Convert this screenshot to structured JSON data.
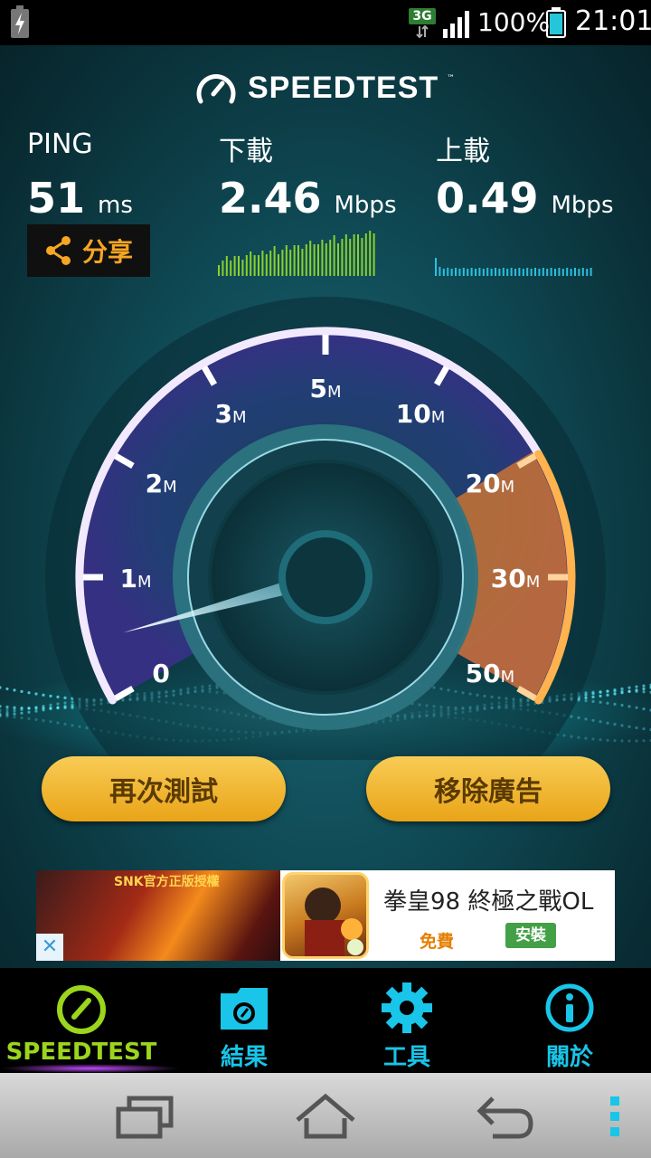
{
  "status_bar": {
    "network": "3G",
    "battery_percent": "100%",
    "time": "21:01"
  },
  "app": {
    "logo_text": "SPEEDTEST",
    "logo_tm": "™"
  },
  "stats": {
    "ping": {
      "label": "PING",
      "value": "51",
      "unit": "ms"
    },
    "download": {
      "label": "下載",
      "value": "2.46",
      "unit": "Mbps"
    },
    "upload": {
      "label": "上載",
      "value": "0.49",
      "unit": "Mbps"
    }
  },
  "share_button": {
    "label": "分享"
  },
  "gauge": {
    "tick_labels": [
      {
        "num": "0",
        "unit": ""
      },
      {
        "num": "1",
        "unit": "M"
      },
      {
        "num": "2",
        "unit": "M"
      },
      {
        "num": "3",
        "unit": "M"
      },
      {
        "num": "5",
        "unit": "M"
      },
      {
        "num": "10",
        "unit": "M"
      },
      {
        "num": "20",
        "unit": "M"
      },
      {
        "num": "30",
        "unit": "M"
      },
      {
        "num": "50",
        "unit": "M"
      }
    ],
    "needle_value_mbps": 0.49
  },
  "actions": {
    "retest": "再次測試",
    "remove_ads": "移除廣告"
  },
  "ad": {
    "banner_text": "SNK官方正版授權",
    "title": "拳皇98 終極之戰OL",
    "free_label": "免費",
    "install_label": "安裝",
    "close_glyph": "✕"
  },
  "tabs": [
    {
      "id": "speedtest",
      "label": "SPEEDTEST",
      "icon": "speedometer-icon",
      "active": true
    },
    {
      "id": "results",
      "label": "結果",
      "icon": "results-folder-icon",
      "active": false
    },
    {
      "id": "tools",
      "label": "工具",
      "icon": "gear-icon",
      "active": false
    },
    {
      "id": "about",
      "label": "關於",
      "icon": "info-icon",
      "active": false
    }
  ],
  "colors": {
    "accent_cyan": "#19c5e8",
    "accent_green": "#9bd51c",
    "button_gold": "#f0b22a",
    "share_orange": "#f6a623"
  }
}
